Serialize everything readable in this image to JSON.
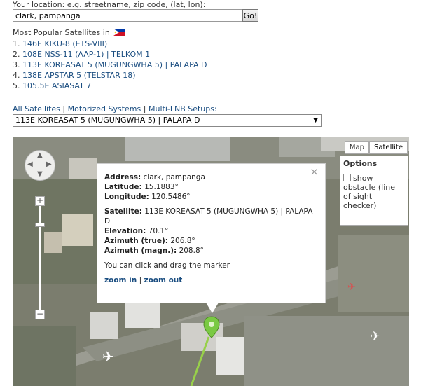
{
  "location": {
    "label": "Your location: e.g. streetname, zip code, (lat, lon):",
    "value": "clark, pampanga",
    "go_label": "Go!"
  },
  "popular": {
    "title": "Most Popular Satellites in",
    "flag_icon": "philippines-flag-icon",
    "items": [
      {
        "num": "1.",
        "label": "146E KIKU-8 (ETS-VIII)"
      },
      {
        "num": "2.",
        "label": "108E NSS-11 (AAP-1) | TELKOM 1"
      },
      {
        "num": "3.",
        "label": "113E KOREASAT 5 (MUGUNGWHA 5) | PALAPA D"
      },
      {
        "num": "4.",
        "label": "138E APSTAR 5 (TELSTAR 18)"
      },
      {
        "num": "5.",
        "label": "105.5E ASIASAT 7"
      }
    ]
  },
  "links": {
    "all": "All Satellites",
    "motorized": "Motorized Systems",
    "multi": "Multi-LNB Setups:",
    "sep": "|"
  },
  "select": {
    "value": "113E KOREASAT 5 (MUGUNGWHA 5) | PALAPA D",
    "arrow": "▼"
  },
  "map": {
    "type_map": "Map",
    "type_satellite": "Satellite",
    "zoom_in_symbol": "+",
    "zoom_out_symbol": "−",
    "options_title": "Options",
    "options_checkbox_label": "show obstacle (line of sight checker)"
  },
  "info": {
    "close": "×",
    "address_label": "Address:",
    "address_value": "clark, pampanga",
    "latitude_label": "Latitude:",
    "latitude_value": "15.1883°",
    "longitude_label": "Longitude:",
    "longitude_value": "120.5486°",
    "satellite_label": "Satellite:",
    "satellite_value": "113E KOREASAT 5 (MUGUNGWHA 5) | PALAPA D",
    "elevation_label": "Elevation:",
    "elevation_value": "70.1°",
    "azimuth_true_label": "Azimuth (true):",
    "azimuth_true_value": "206.8°",
    "azimuth_magn_label": "Azimuth (magn.):",
    "azimuth_magn_value": "208.8°",
    "drag_note": "You can click and drag the marker",
    "zoom_in": "zoom in",
    "zoom_out": "zoom out",
    "sep": "|"
  }
}
